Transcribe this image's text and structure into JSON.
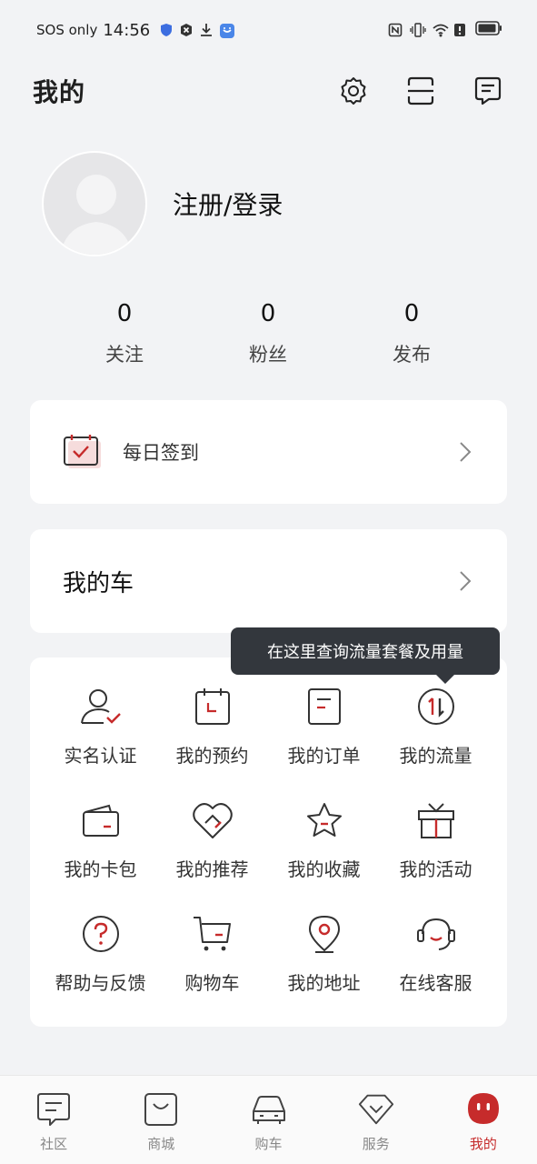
{
  "status_bar": {
    "carrier": "SOS only",
    "time": "14:56"
  },
  "header": {
    "title": "我的",
    "icons": [
      "settings-icon",
      "scan-icon",
      "message-icon"
    ]
  },
  "profile": {
    "login_label": "注册/登录"
  },
  "stats": [
    {
      "value": "0",
      "label": "关注"
    },
    {
      "value": "0",
      "label": "粉丝"
    },
    {
      "value": "0",
      "label": "发布"
    }
  ],
  "signin": {
    "label": "每日签到"
  },
  "my_car": {
    "label": "我的车"
  },
  "tooltip": {
    "text": "在这里查询流量套餐及用量"
  },
  "services": [
    {
      "label": "实名认证",
      "icon": "user-verify-icon"
    },
    {
      "label": "我的预约",
      "icon": "calendar-icon"
    },
    {
      "label": "我的订单",
      "icon": "order-icon"
    },
    {
      "label": "我的流量",
      "icon": "data-traffic-icon"
    },
    {
      "label": "我的卡包",
      "icon": "wallet-icon"
    },
    {
      "label": "我的推荐",
      "icon": "recommend-icon"
    },
    {
      "label": "我的收藏",
      "icon": "star-icon"
    },
    {
      "label": "我的活动",
      "icon": "gift-icon"
    },
    {
      "label": "帮助与反馈",
      "icon": "help-icon"
    },
    {
      "label": "购物车",
      "icon": "cart-icon"
    },
    {
      "label": "我的地址",
      "icon": "location-icon"
    },
    {
      "label": "在线客服",
      "icon": "headset-icon"
    }
  ],
  "tabs": [
    {
      "label": "社区",
      "icon": "community-icon",
      "active": false
    },
    {
      "label": "商城",
      "icon": "mall-icon",
      "active": false
    },
    {
      "label": "购车",
      "icon": "car-icon",
      "active": false
    },
    {
      "label": "服务",
      "icon": "service-icon",
      "active": false
    },
    {
      "label": "我的",
      "icon": "me-icon",
      "active": true
    }
  ],
  "colors": {
    "accent": "#c62b2b",
    "background": "#f2f3f5",
    "card": "#ffffff",
    "tooltip": "#33373d"
  }
}
